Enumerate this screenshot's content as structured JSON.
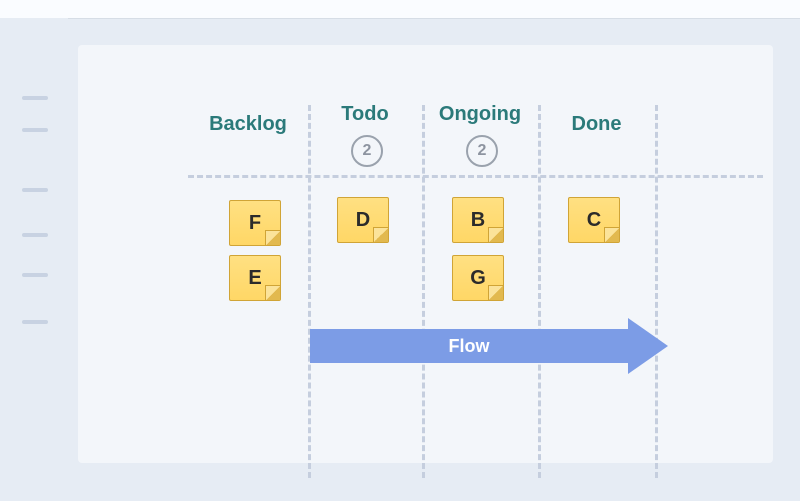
{
  "board": {
    "columns": [
      {
        "key": "backlog",
        "label": "Backlog",
        "limit": null
      },
      {
        "key": "todo",
        "label": "Todo",
        "limit": 2
      },
      {
        "key": "ongoing",
        "label": "Ongoing",
        "limit": 2
      },
      {
        "key": "done",
        "label": "Done",
        "limit": null
      }
    ],
    "cards": {
      "backlog": [
        "F",
        "E"
      ],
      "todo": [
        "D"
      ],
      "ongoing": [
        "B",
        "G"
      ],
      "done": [
        "C"
      ]
    },
    "flow_label": "Flow"
  },
  "colors": {
    "page_bg": "#e6ecf4",
    "board_bg": "#f3f6fa",
    "heading": "#2b7a7a",
    "arrow": "#7c9ce6",
    "note": "#ffd766",
    "dash": "#c5cede"
  }
}
